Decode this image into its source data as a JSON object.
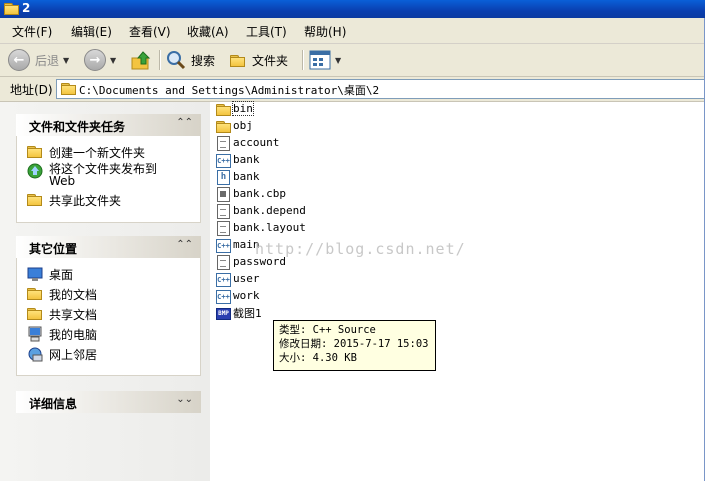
{
  "window": {
    "title": "2"
  },
  "menu": [
    "文件(F)",
    "编辑(E)",
    "查看(V)",
    "收藏(A)",
    "工具(T)",
    "帮助(H)"
  ],
  "toolbar": {
    "back_label": "后退",
    "search_label": "搜索",
    "folders_label": "文件夹"
  },
  "address": {
    "label": "地址(D)",
    "path": "C:\\Documents and Settings\\Administrator\\桌面\\2"
  },
  "tasks": {
    "title": "文件和文件夹任务",
    "items": [
      {
        "label": "创建一个新文件夹",
        "icon": "new-folder-icon"
      },
      {
        "label": "将这个文件夹发布到 Web",
        "icon": "publish-web-icon"
      },
      {
        "label": "共享此文件夹",
        "icon": "share-folder-icon"
      }
    ]
  },
  "places": {
    "title": "其它位置",
    "items": [
      {
        "label": "桌面",
        "icon": "desktop-icon"
      },
      {
        "label": "我的文档",
        "icon": "my-documents-icon"
      },
      {
        "label": "共享文档",
        "icon": "shared-documents-icon"
      },
      {
        "label": "我的电脑",
        "icon": "my-computer-icon"
      },
      {
        "label": "网上邻居",
        "icon": "network-places-icon"
      }
    ]
  },
  "details": {
    "title": "详细信息"
  },
  "files": [
    {
      "name": "bin",
      "type": "folder"
    },
    {
      "name": "obj",
      "type": "folder"
    },
    {
      "name": "account",
      "type": "text"
    },
    {
      "name": "bank",
      "type": "cpp"
    },
    {
      "name": "bank",
      "type": "header"
    },
    {
      "name": "bank.cbp",
      "type": "codeblocks"
    },
    {
      "name": "bank.depend",
      "type": "text"
    },
    {
      "name": "bank.layout",
      "type": "text"
    },
    {
      "name": "main",
      "type": "cpp"
    },
    {
      "name": "password",
      "type": "text"
    },
    {
      "name": "user",
      "type": "cpp"
    },
    {
      "name": "work",
      "type": "cpp"
    },
    {
      "name": "截图1",
      "type": "bitmap"
    }
  ],
  "tooltip": {
    "type_line": "类型: C++ Source",
    "date_line": "修改日期: 2015-7-17 15:03",
    "size_line": "大小: 4.30 KB"
  },
  "watermark": "http://blog.csdn.net/",
  "colors": {
    "titlebar": "#0a3fb0",
    "chrome": "#ece9d8",
    "tooltip_bg": "#ffffe1"
  }
}
